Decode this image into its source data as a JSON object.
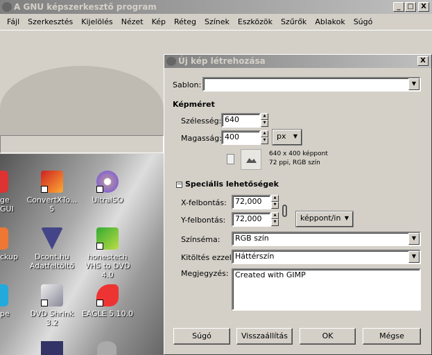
{
  "main_window": {
    "title": "A GNU képszerkesztő program",
    "controls": {
      "minimize": "_",
      "maximize": "□",
      "close": "X"
    }
  },
  "menu": [
    "Fájl",
    "Szerkesztés",
    "Kijelölés",
    "Nézet",
    "Kép",
    "Réteg",
    "Színek",
    "Eszközök",
    "Szűrők",
    "Ablakok",
    "Súgó"
  ],
  "desktop_icons": [
    {
      "label": "ge GUI",
      "icon": "app-icon"
    },
    {
      "label": "ConvertXTo... 5",
      "icon": "convertx-icon"
    },
    {
      "label": "UltraISO",
      "icon": "disc-icon"
    },
    {
      "label": "ckup",
      "icon": "backup-icon"
    },
    {
      "label": "Dcont.hu Adatfeltöltő",
      "icon": "dcont-icon"
    },
    {
      "label": "honestech VHS to DVD 4.0",
      "icon": "vhs-icon"
    },
    {
      "label": "pe",
      "icon": "skype-icon"
    },
    {
      "label": "DVD Shrink 3.2",
      "icon": "dvdshrink-icon"
    },
    {
      "label": "EAGLE 5.10.0",
      "icon": "eagle-icon"
    }
  ],
  "dialog": {
    "title": "Új kép létrehozása",
    "close": "X",
    "template_label": "Sablon:",
    "template_value": "",
    "size_header": "Képméret",
    "width_label": "Szélesség:",
    "width_value": "640",
    "height_label": "Magasság:",
    "height_value": "400",
    "unit": "px",
    "info_line1": "640 x 400 képpont",
    "info_line2": "72 ppi, RGB szín",
    "advanced_header": "Speciális lehetőségek",
    "advanced_toggle": "−",
    "xres_label": "X-felbontás:",
    "xres_value": "72,000",
    "yres_label": "Y-felbontás:",
    "yres_value": "72,000",
    "res_unit": "képpont/in",
    "colorspace_label": "Színséma:",
    "colorspace_value": "RGB szín",
    "fill_label": "Kitöltés ezzel:",
    "fill_value": "Háttérszín",
    "comment_label": "Megjegyzés:",
    "comment_value": "Created with GIMP",
    "buttons": {
      "help": "Súgó",
      "reset": "Visszaállítás",
      "ok": "OK",
      "cancel": "Mégse"
    }
  }
}
